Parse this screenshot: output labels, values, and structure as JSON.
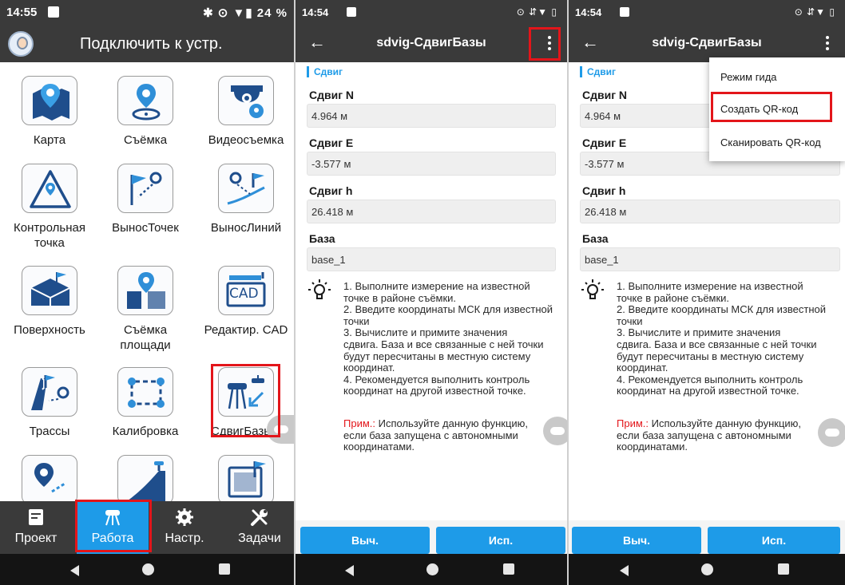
{
  "panel1": {
    "status": {
      "time": "14:55",
      "right": "✱ ⊙ ▼▮ 24 %"
    },
    "header": {
      "title": "Подключить к устр."
    },
    "grid": [
      {
        "label": "Карта",
        "icon": "map-pin-icon"
      },
      {
        "label": "Съёмка",
        "icon": "survey-pin-icon"
      },
      {
        "label": "Видеосъемка",
        "icon": "camera-icon"
      },
      {
        "label": "Контрольная точка",
        "icon": "control-point-icon"
      },
      {
        "label": "ВыносТочек",
        "icon": "stakeout-point-icon"
      },
      {
        "label": "ВыносЛиний",
        "icon": "stakeout-line-icon"
      },
      {
        "label": "Поверхность",
        "icon": "surface-icon"
      },
      {
        "label": "Съёмка площади",
        "icon": "area-survey-icon"
      },
      {
        "label": "Редактир. CAD",
        "icon": "cad-icon"
      },
      {
        "label": "Трассы",
        "icon": "road-icon"
      },
      {
        "label": "Калибровка",
        "icon": "calibration-icon"
      },
      {
        "label": "СдвигБазы",
        "icon": "base-shift-icon"
      },
      {
        "label": "",
        "icon": "point-nav-icon"
      },
      {
        "label": "",
        "icon": "slope-icon"
      },
      {
        "label": "",
        "icon": "flag-map-icon"
      }
    ],
    "cad_text": "CAD",
    "bottom_nav": [
      {
        "label": "Проект",
        "icon": "project-icon"
      },
      {
        "label": "Работа",
        "icon": "receiver-icon"
      },
      {
        "label": "Настр.",
        "icon": "gear-icon"
      },
      {
        "label": "Задачи",
        "icon": "tools-icon"
      }
    ]
  },
  "shift": {
    "status_time": "14:54",
    "status_right": "⊙ ⇵▼ ▯",
    "title": "sdvig-СдвигБазы",
    "section": "Сдвиг",
    "fields": [
      {
        "label": "Сдвиг N",
        "value": "4.964 м"
      },
      {
        "label": "Сдвиг E",
        "value": "-3.577 м"
      },
      {
        "label": "Сдвиг h",
        "value": "26.418 м"
      },
      {
        "label": "База",
        "value": "base_1"
      }
    ],
    "hint": "1. Выполните измерение на известной\nточке в районе съёмки.\n2. Введите координаты МСК для известной\nточки\n3. Вычислите и примите значения\nсдвига. База и все связанные с ней точки\nбудут пересчитаны в местную систему\nкоординат.\n4. Рекомендуется выполнить контроль\nкоординат на другой известной точке.",
    "note_label": "Прим.:",
    "note_text": " Используйте данную функцию,\nесли база запущена с автономными\nкоординатами.",
    "calc_button": "Выч.",
    "apply_button": "Исп."
  },
  "menu": {
    "items": [
      "Режим гида",
      "Создать QR-код",
      "Сканировать QR-код"
    ]
  }
}
